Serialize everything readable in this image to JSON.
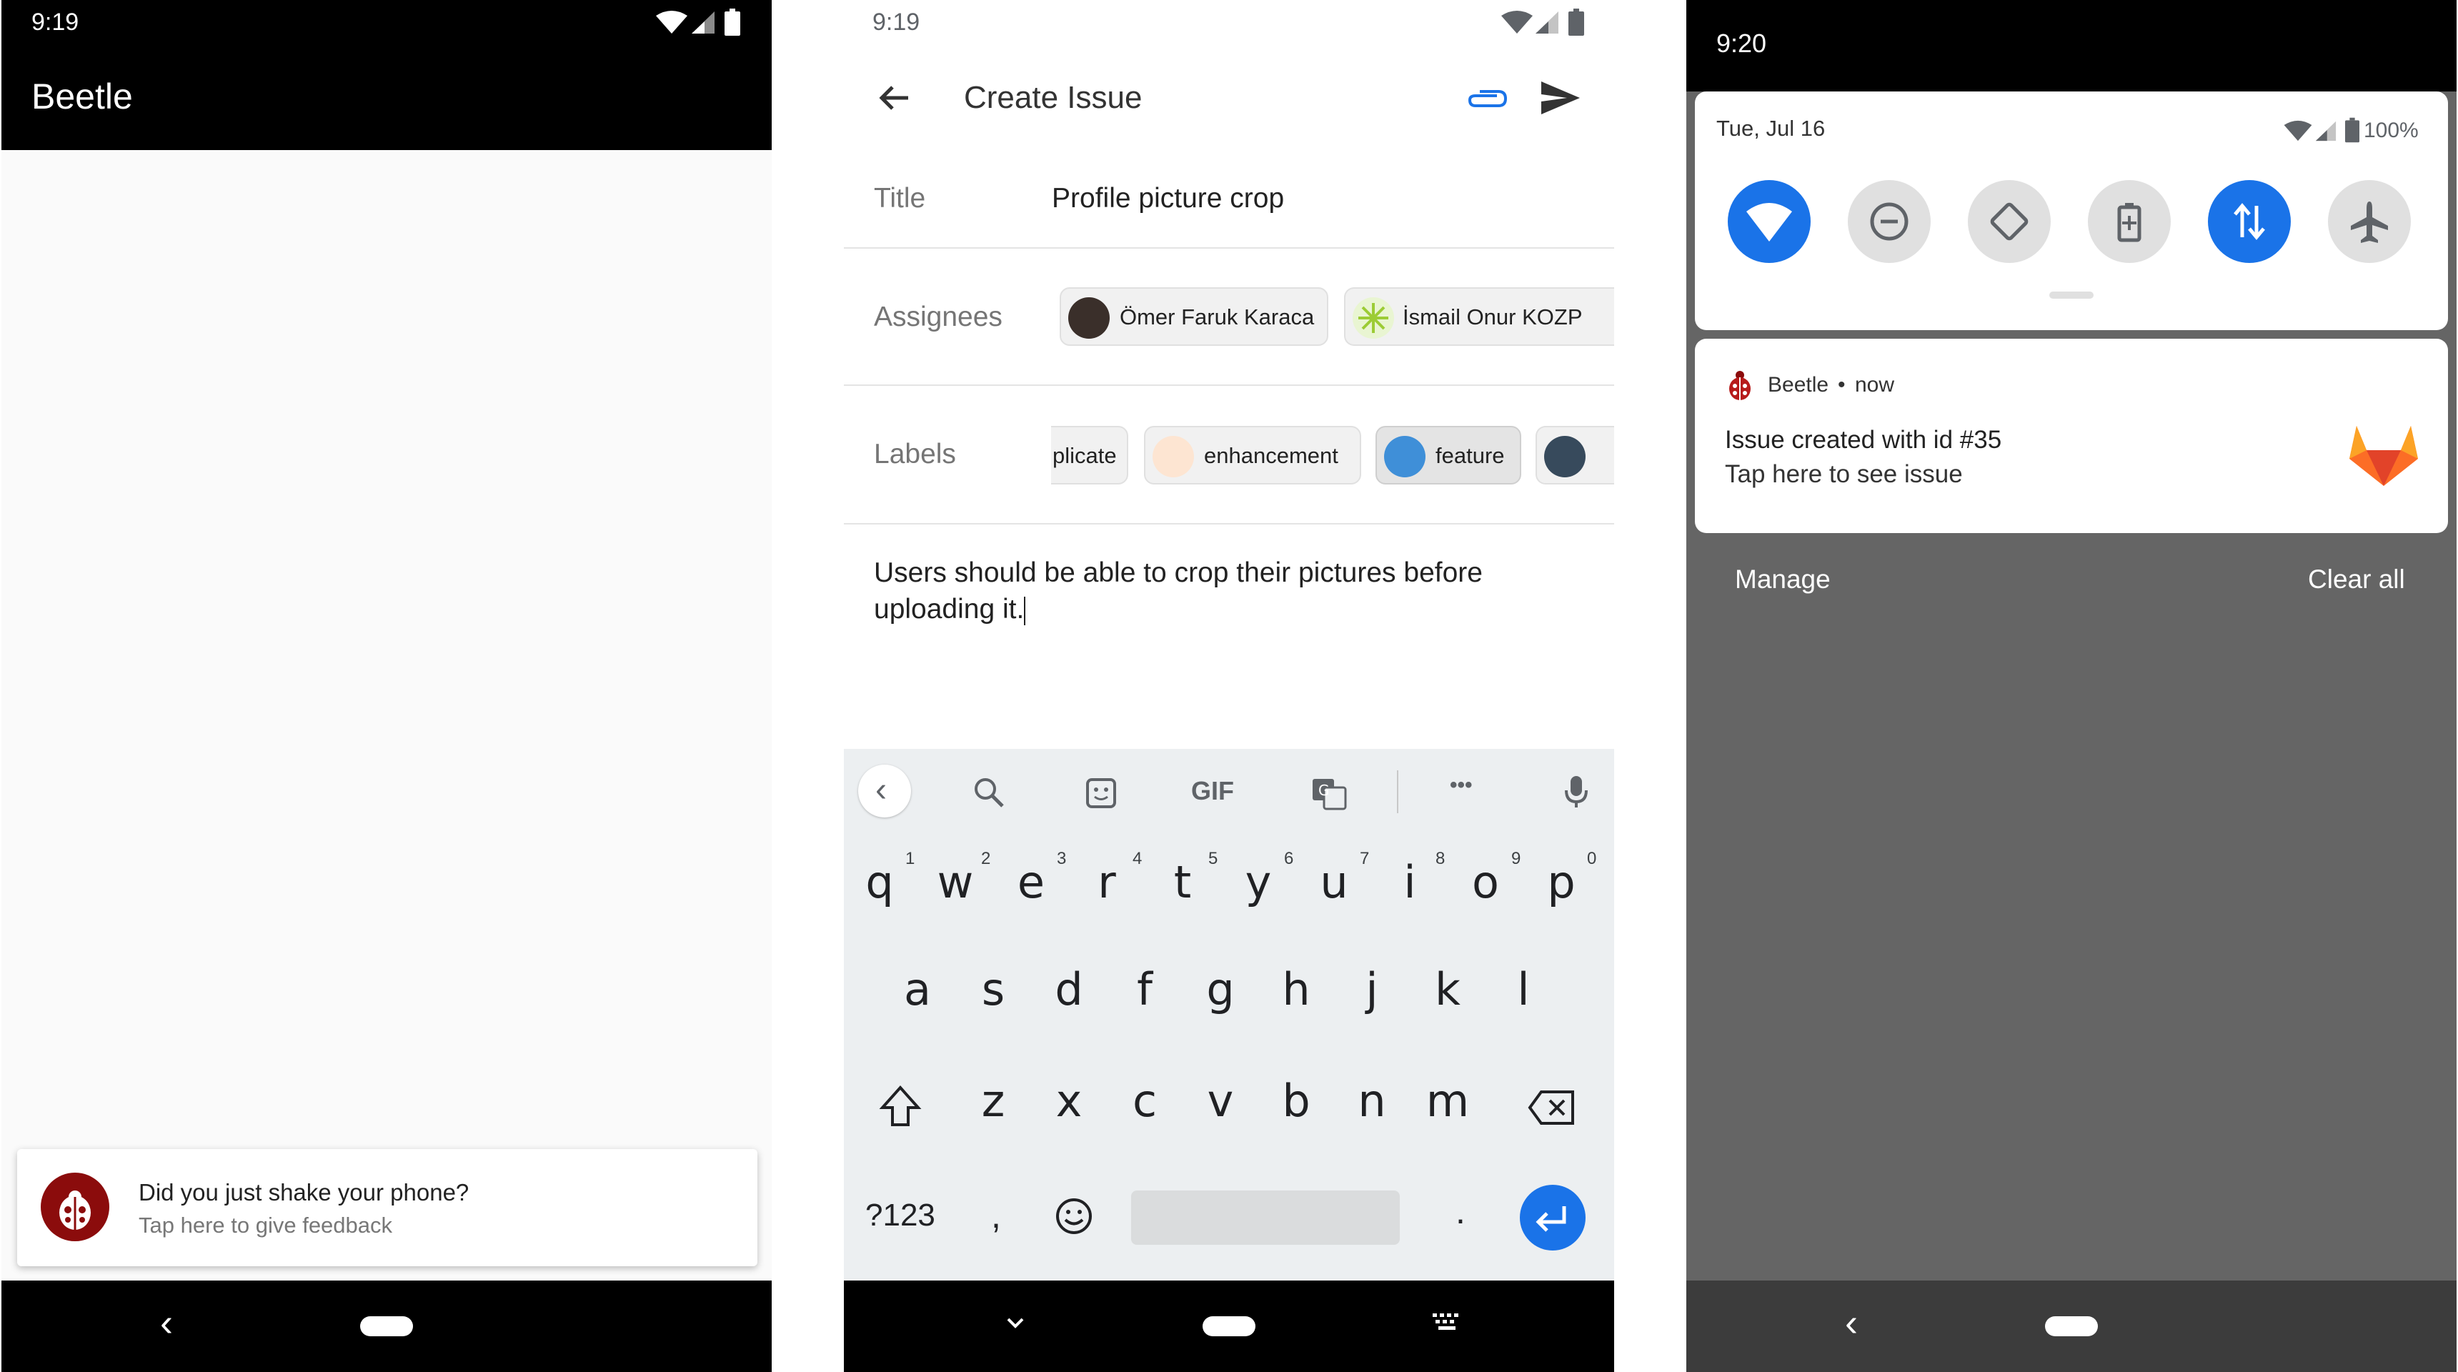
{
  "phone1": {
    "status_time": "9:19",
    "app_title": "Beetle",
    "snackbar": {
      "title": "Did you just shake your phone?",
      "subtitle": "Tap here to give feedback"
    },
    "nav_back": "‹"
  },
  "phone2": {
    "status_time": "9:19",
    "toolbar_title": "Create Issue",
    "title_label": "Title",
    "title_value": "Profile picture crop",
    "assignees_label": "Assignees",
    "assignees": [
      "Ömer Faruk Karaca",
      "İsmail Onur KOZP"
    ],
    "labels_label": "Labels",
    "labels": [
      "plicate",
      "enhancement",
      "feature"
    ],
    "label_colors": [
      "#fde5d2",
      "#3f8fd8",
      "#374a5c"
    ],
    "description": "Users should be able to crop their pictures before uploading it.",
    "keyboard": {
      "toolbar": {
        "back": "‹",
        "gif": "GIF",
        "more": "•••"
      },
      "row1": [
        "q",
        "w",
        "e",
        "r",
        "t",
        "y",
        "u",
        "i",
        "o",
        "p"
      ],
      "row1_hints": [
        "1",
        "2",
        "3",
        "4",
        "5",
        "6",
        "7",
        "8",
        "9",
        "0"
      ],
      "row2": [
        "a",
        "s",
        "d",
        "f",
        "g",
        "h",
        "j",
        "k",
        "l"
      ],
      "row3": [
        "z",
        "x",
        "c",
        "v",
        "b",
        "n",
        "m"
      ],
      "symbols_key": "?123",
      "comma": ",",
      "period": "."
    }
  },
  "phone3": {
    "status_time": "9:20",
    "date": "Tue, Jul 16",
    "battery": "100%",
    "notification": {
      "app": "Beetle",
      "when": "now",
      "separator": "•",
      "title": "Issue created with id #35",
      "text": "Tap here to see issue"
    },
    "manage": "Manage",
    "clear_all": "Clear all",
    "nav_back": "‹"
  },
  "colors": {
    "accent_blue": "#1a73e8",
    "beetle_red": "#8b0c0c",
    "gitlab_orange": "#fc6d26"
  }
}
